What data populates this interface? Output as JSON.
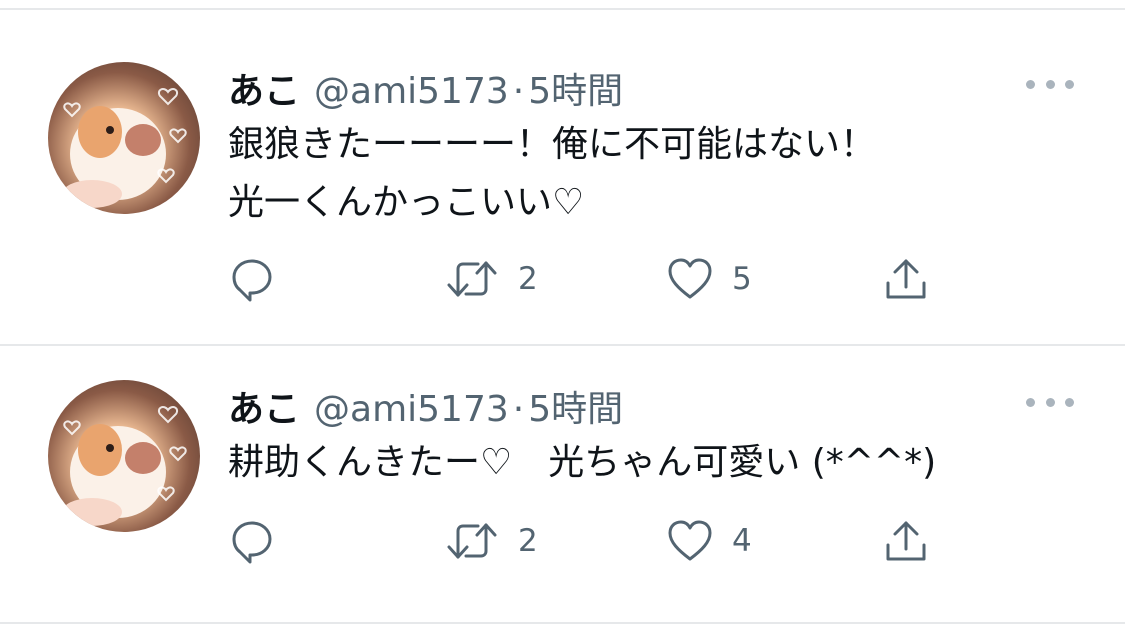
{
  "tweets": [
    {
      "name": "あこ",
      "handle": "@ami5173",
      "separator": "·",
      "time": "5時間",
      "text": "銀狼きたーーーー！俺に不可能はない！\n光一くんかっこいい♡",
      "reply_icon": "reply-icon",
      "retweet_icon": "retweet-icon",
      "retweet_count": "2",
      "like_icon": "heart-icon",
      "like_count": "5",
      "share_icon": "share-icon"
    },
    {
      "name": "あこ",
      "handle": "@ami5173",
      "separator": "·",
      "time": "5時間",
      "text": "耕助くんきたー♡　光ちゃん可愛い (*^^*)",
      "reply_icon": "reply-icon",
      "retweet_icon": "retweet-icon",
      "retweet_count": "2",
      "like_icon": "heart-icon",
      "like_count": "4",
      "share_icon": "share-icon"
    }
  ],
  "colors": {
    "text_primary": "#0f1419",
    "text_secondary": "#536471",
    "icon": "#536471",
    "divider": "#e6e8ea"
  }
}
